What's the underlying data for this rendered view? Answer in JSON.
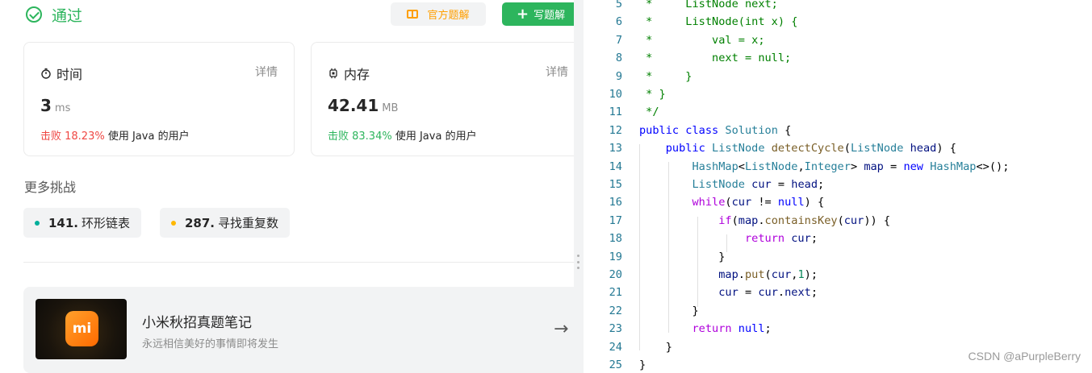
{
  "result": {
    "status": "通过"
  },
  "actions": {
    "official_solution": "官方题解",
    "write_solution": "写题解"
  },
  "runtime": {
    "label": "时间",
    "detail": "详情",
    "value": "3",
    "unit": "ms",
    "beat_text": "击败 18.23%",
    "beat_suffix": "使用 Java 的用户"
  },
  "memory": {
    "label": "内存",
    "detail": "详情",
    "value": "42.41",
    "unit": "MB",
    "beat_text": "击败 83.34%",
    "beat_suffix": "使用 Java 的用户"
  },
  "more": {
    "title": "更多挑战",
    "items": [
      {
        "number": "141.",
        "title": "环形链表",
        "dot_color": "#00af9b"
      },
      {
        "number": "287.",
        "title": "寻找重复数",
        "dot_color": "#ffb800"
      }
    ]
  },
  "promo": {
    "title": "小米秋招真题笔记",
    "subtitle": "永远相信美好的事情即将发生",
    "logo_text": "mi"
  },
  "editor": {
    "lines": [
      {
        "n": "5",
        "tokens": [
          {
            "t": " *     ListNode next;",
            "c": "com"
          }
        ]
      },
      {
        "n": "6",
        "tokens": [
          {
            "t": " *     ListNode(int x) {",
            "c": "com"
          }
        ]
      },
      {
        "n": "7",
        "tokens": [
          {
            "t": " *         val = x;",
            "c": "com"
          }
        ]
      },
      {
        "n": "8",
        "tokens": [
          {
            "t": " *         next = null;",
            "c": "com"
          }
        ]
      },
      {
        "n": "9",
        "tokens": [
          {
            "t": " *     }",
            "c": "com"
          }
        ]
      },
      {
        "n": "10",
        "tokens": [
          {
            "t": " * }",
            "c": "com"
          }
        ]
      },
      {
        "n": "11",
        "tokens": [
          {
            "t": " */",
            "c": "com"
          }
        ]
      },
      {
        "n": "12",
        "tokens": [
          {
            "t": "public",
            "c": "kw"
          },
          {
            "t": " ",
            "c": "pl"
          },
          {
            "t": "class",
            "c": "kw"
          },
          {
            "t": " ",
            "c": "pl"
          },
          {
            "t": "Solution",
            "c": "type"
          },
          {
            "t": " {",
            "c": "pl"
          }
        ]
      },
      {
        "n": "13",
        "tokens": [
          {
            "t": "    ",
            "c": "pl"
          },
          {
            "t": "public",
            "c": "kw"
          },
          {
            "t": " ",
            "c": "pl"
          },
          {
            "t": "ListNode",
            "c": "type"
          },
          {
            "t": " ",
            "c": "pl"
          },
          {
            "t": "detectCycle",
            "c": "fn"
          },
          {
            "t": "(",
            "c": "pl"
          },
          {
            "t": "ListNode",
            "c": "type"
          },
          {
            "t": " ",
            "c": "pl"
          },
          {
            "t": "head",
            "c": "var"
          },
          {
            "t": ") {",
            "c": "pl"
          }
        ]
      },
      {
        "n": "14",
        "tokens": [
          {
            "t": "        ",
            "c": "pl"
          },
          {
            "t": "HashMap",
            "c": "type"
          },
          {
            "t": "<",
            "c": "pl"
          },
          {
            "t": "ListNode",
            "c": "type"
          },
          {
            "t": ",",
            "c": "pl"
          },
          {
            "t": "Integer",
            "c": "type"
          },
          {
            "t": "> ",
            "c": "pl"
          },
          {
            "t": "map",
            "c": "var"
          },
          {
            "t": " = ",
            "c": "pl"
          },
          {
            "t": "new",
            "c": "kw"
          },
          {
            "t": " ",
            "c": "pl"
          },
          {
            "t": "HashMap",
            "c": "type"
          },
          {
            "t": "<>();",
            "c": "pl"
          }
        ]
      },
      {
        "n": "15",
        "tokens": [
          {
            "t": "        ",
            "c": "pl"
          },
          {
            "t": "ListNode",
            "c": "type"
          },
          {
            "t": " ",
            "c": "pl"
          },
          {
            "t": "cur",
            "c": "var"
          },
          {
            "t": " = ",
            "c": "pl"
          },
          {
            "t": "head",
            "c": "var"
          },
          {
            "t": ";",
            "c": "pl"
          }
        ]
      },
      {
        "n": "16",
        "tokens": [
          {
            "t": "        ",
            "c": "pl"
          },
          {
            "t": "while",
            "c": "ctl"
          },
          {
            "t": "(",
            "c": "pl"
          },
          {
            "t": "cur",
            "c": "var"
          },
          {
            "t": " != ",
            "c": "pl"
          },
          {
            "t": "null",
            "c": "kw"
          },
          {
            "t": ") {",
            "c": "pl"
          }
        ]
      },
      {
        "n": "17",
        "tokens": [
          {
            "t": "            ",
            "c": "pl"
          },
          {
            "t": "if",
            "c": "ctl"
          },
          {
            "t": "(",
            "c": "pl"
          },
          {
            "t": "map",
            "c": "var"
          },
          {
            "t": ".",
            "c": "pl"
          },
          {
            "t": "containsKey",
            "c": "fn"
          },
          {
            "t": "(",
            "c": "pl"
          },
          {
            "t": "cur",
            "c": "var"
          },
          {
            "t": ")) {",
            "c": "pl"
          }
        ]
      },
      {
        "n": "18",
        "tokens": [
          {
            "t": "                ",
            "c": "pl"
          },
          {
            "t": "return",
            "c": "ctl"
          },
          {
            "t": " ",
            "c": "pl"
          },
          {
            "t": "cur",
            "c": "var"
          },
          {
            "t": ";",
            "c": "pl"
          }
        ]
      },
      {
        "n": "19",
        "tokens": [
          {
            "t": "            }",
            "c": "pl"
          }
        ]
      },
      {
        "n": "20",
        "tokens": [
          {
            "t": "            ",
            "c": "pl"
          },
          {
            "t": "map",
            "c": "var"
          },
          {
            "t": ".",
            "c": "pl"
          },
          {
            "t": "put",
            "c": "fn"
          },
          {
            "t": "(",
            "c": "pl"
          },
          {
            "t": "cur",
            "c": "var"
          },
          {
            "t": ",",
            "c": "pl"
          },
          {
            "t": "1",
            "c": "num"
          },
          {
            "t": ");",
            "c": "pl"
          }
        ]
      },
      {
        "n": "21",
        "tokens": [
          {
            "t": "            ",
            "c": "pl"
          },
          {
            "t": "cur",
            "c": "var"
          },
          {
            "t": " = ",
            "c": "pl"
          },
          {
            "t": "cur",
            "c": "var"
          },
          {
            "t": ".",
            "c": "pl"
          },
          {
            "t": "next",
            "c": "var"
          },
          {
            "t": ";",
            "c": "pl"
          }
        ]
      },
      {
        "n": "22",
        "tokens": [
          {
            "t": "        }",
            "c": "pl"
          }
        ]
      },
      {
        "n": "23",
        "tokens": [
          {
            "t": "        ",
            "c": "pl"
          },
          {
            "t": "return",
            "c": "ctl"
          },
          {
            "t": " ",
            "c": "pl"
          },
          {
            "t": "null",
            "c": "kw"
          },
          {
            "t": ";",
            "c": "pl"
          }
        ]
      },
      {
        "n": "24",
        "tokens": [
          {
            "t": "    }",
            "c": "pl"
          }
        ]
      },
      {
        "n": "25",
        "tokens": [
          {
            "t": "}",
            "c": "pl"
          }
        ]
      }
    ]
  },
  "watermark": "CSDN @aPurpleBerry",
  "colors": {
    "accent_green": "#2db55d",
    "beat_red": "#ef4743",
    "official_orange": "#ff9f00"
  }
}
